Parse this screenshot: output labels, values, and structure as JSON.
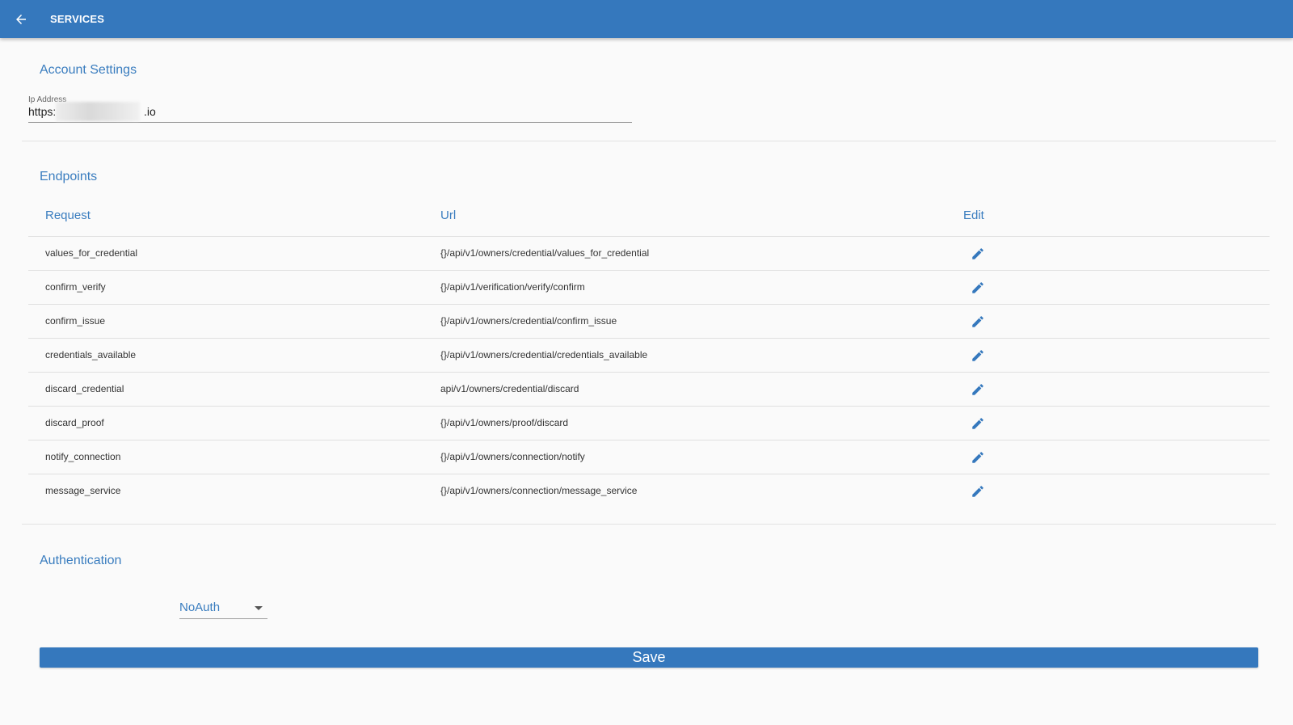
{
  "appbar": {
    "title": "SERVICES",
    "back_icon": "arrow-left-icon",
    "color": "#3578bd"
  },
  "account": {
    "title": "Account Settings",
    "ip_label": "Ip Address",
    "ip_prefix": "https:",
    "ip_suffix": ".io"
  },
  "endpoints": {
    "title": "Endpoints",
    "columns": [
      "Request",
      "Url",
      "Edit"
    ],
    "rows": [
      {
        "request": "values_for_credential",
        "url": "{}/api/v1/owners/credential/values_for_credential"
      },
      {
        "request": "confirm_verify",
        "url": "{}/api/v1/verification/verify/confirm"
      },
      {
        "request": "confirm_issue",
        "url": "{}/api/v1/owners/credential/confirm_issue"
      },
      {
        "request": "credentials_available",
        "url": "{}/api/v1/owners/credential/credentials_available"
      },
      {
        "request": "discard_credential",
        "url": "api/v1/owners/credential/discard"
      },
      {
        "request": "discard_proof",
        "url": "{}/api/v1/owners/proof/discard"
      },
      {
        "request": "notify_connection",
        "url": "{}/api/v1/owners/connection/notify"
      },
      {
        "request": "message_service",
        "url": "{}/api/v1/owners/connection/message_service"
      }
    ],
    "edit_icon": "pencil-icon"
  },
  "authentication": {
    "title": "Authentication",
    "selected": "NoAuth"
  },
  "save_label": "Save",
  "accent_color": "#3a7dbf"
}
